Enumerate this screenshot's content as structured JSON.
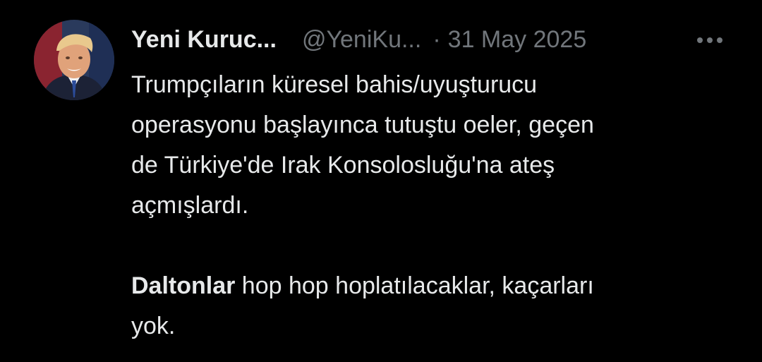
{
  "tweet": {
    "display_name": "Yeni Kuruc...",
    "handle": "@YeniKu...",
    "separator": "·",
    "date": "31 May 2025",
    "more_icon": "more-dots-icon",
    "avatar_icon": "profile-avatar",
    "paragraph1_lines": [
      "Trumpçıların küresel bahis/uyuşturucu",
      "operasyonu başlayınca tutuştu oeler, geçen",
      "de Türkiye'de Irak Konsolosluğu'na ateş",
      "açmışlardı."
    ],
    "paragraph2": {
      "bold_word": "Daltonlar",
      "line1_rest": " hop hop hoplatılacaklar, kaçarları",
      "line2": "yok."
    }
  },
  "colors": {
    "background": "#000000",
    "primary_text": "#e7e9ea",
    "secondary_text": "#71767b"
  }
}
